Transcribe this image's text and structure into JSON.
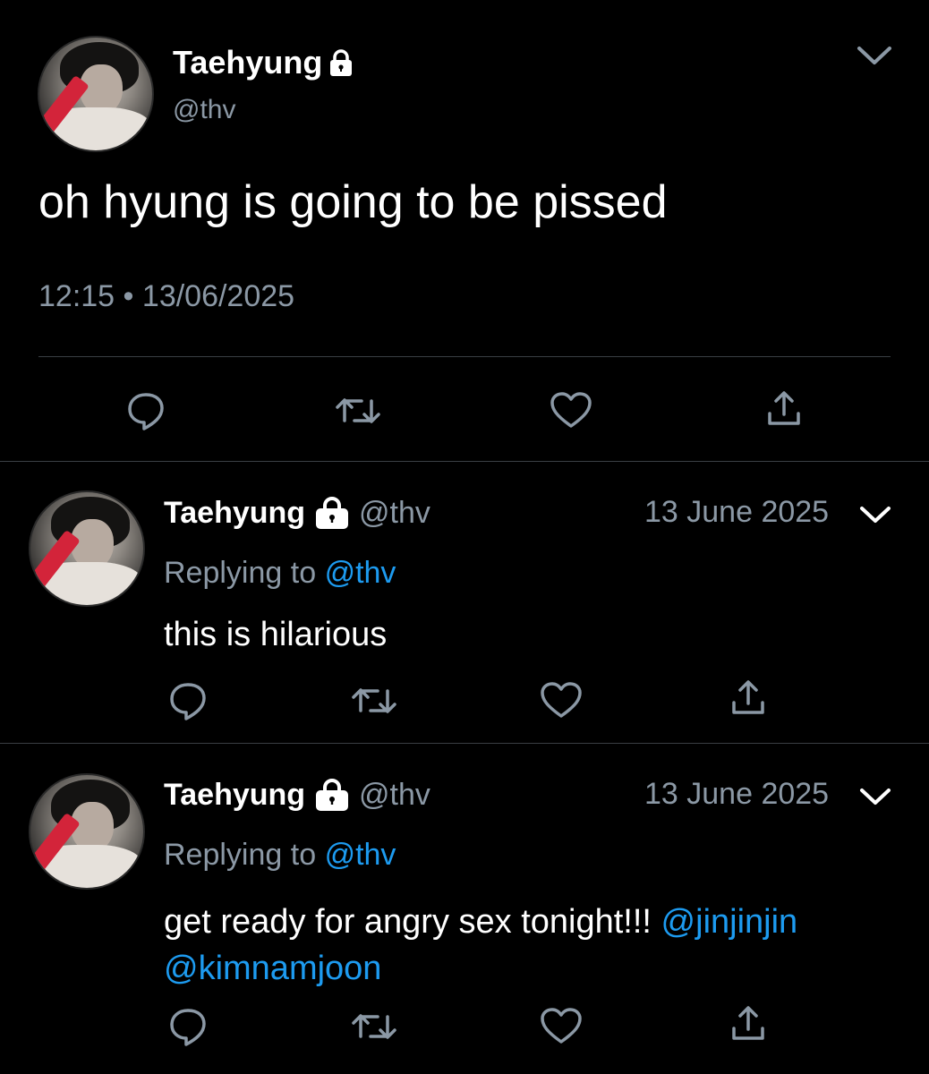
{
  "main_tweet": {
    "name": "Taehyung",
    "handle": "@thv",
    "text": "oh hyung is going to be pissed",
    "time": "12:15",
    "separator": "•",
    "date": "13/06/2025"
  },
  "replies": [
    {
      "name": "Taehyung",
      "handle": "@thv",
      "date": "13 June 2025",
      "replying_prefix": "Replying to",
      "replying_handle": "@thv",
      "text": "this is hilarious",
      "mentions": []
    },
    {
      "name": "Taehyung",
      "handle": "@thv",
      "date": "13 June 2025",
      "replying_prefix": "Replying to",
      "replying_handle": "@thv",
      "text": "get ready for angry sex tonight!!!",
      "mentions": [
        "@jinjinjin",
        "@kimnamjoon"
      ]
    }
  ],
  "icons": [
    "lock-icon",
    "chevron-down-icon",
    "reply-icon",
    "retweet-icon",
    "like-icon",
    "share-icon"
  ],
  "colors": {
    "background": "#000000",
    "text": "#ffffff",
    "secondary": "#8b98a5",
    "link": "#1d9bf0",
    "divider": "#3a3f44"
  }
}
